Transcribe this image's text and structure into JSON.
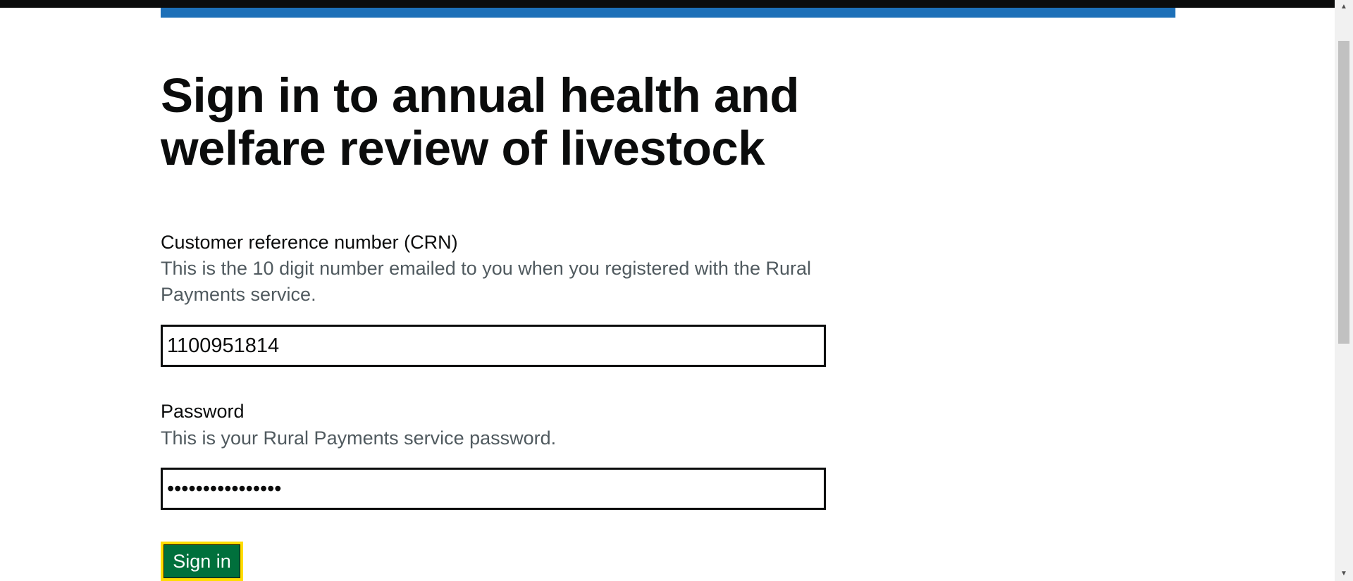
{
  "page": {
    "title": "Sign in to annual health and welfare review of livestock"
  },
  "crn": {
    "label": "Customer reference number (CRN)",
    "hint": "This is the 10 digit number emailed to you when you registered with the Rural Payments service.",
    "value": "1100951814"
  },
  "password": {
    "label": "Password",
    "hint": "This is your Rural Payments service password.",
    "value": "••••••••••••••••"
  },
  "actions": {
    "sign_in_label": "Sign in"
  },
  "colors": {
    "header": "#0b0c0c",
    "brand_blue": "#1d70b8",
    "button_green": "#00703c",
    "focus_yellow": "#ffdd00",
    "hint_grey": "#505a5f"
  },
  "scrollbar": {
    "up_icon": "triangle-up",
    "down_icon": "triangle-down"
  }
}
